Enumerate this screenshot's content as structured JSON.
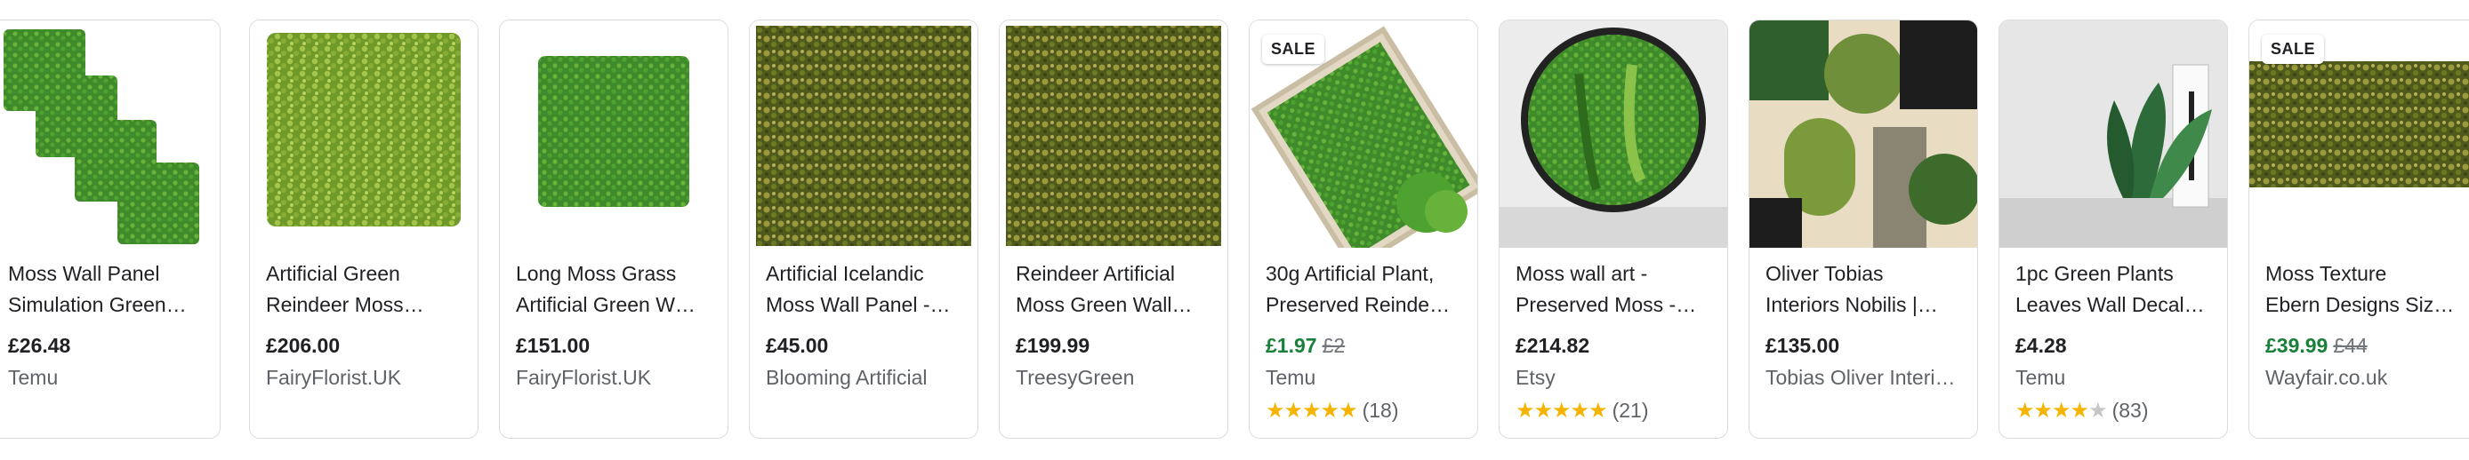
{
  "products": [
    {
      "title1": "Moss Wall Panel",
      "title2": "Simulation Green…",
      "price": "£26.48",
      "old_price": null,
      "sale": false,
      "seller": "Temu",
      "rating": null,
      "reviews": null,
      "badge": null
    },
    {
      "title1": "Artificial Green",
      "title2": "Reindeer Moss…",
      "price": "£206.00",
      "old_price": null,
      "sale": false,
      "seller": "FairyFlorist.UK",
      "rating": null,
      "reviews": null,
      "badge": null
    },
    {
      "title1": "Long Moss Grass",
      "title2": "Artificial Green W…",
      "price": "£151.00",
      "old_price": null,
      "sale": false,
      "seller": "FairyFlorist.UK",
      "rating": null,
      "reviews": null,
      "badge": null
    },
    {
      "title1": "Artificial Icelandic",
      "title2": "Moss Wall Panel -…",
      "price": "£45.00",
      "old_price": null,
      "sale": false,
      "seller": "Blooming Artificial",
      "rating": null,
      "reviews": null,
      "badge": null
    },
    {
      "title1": "Reindeer Artificial",
      "title2": "Moss Green Wall…",
      "price": "£199.99",
      "old_price": null,
      "sale": false,
      "seller": "TreesyGreen",
      "rating": null,
      "reviews": null,
      "badge": null
    },
    {
      "title1": "30g Artificial Plant,",
      "title2": "Preserved Reinde…",
      "price": "£1.97",
      "old_price": "£2",
      "sale": true,
      "seller": "Temu",
      "rating": 4.5,
      "reviews": "(18)",
      "badge": "SALE"
    },
    {
      "title1": "Moss wall art -",
      "title2": "Preserved Moss -…",
      "price": "£214.82",
      "old_price": null,
      "sale": false,
      "seller": "Etsy",
      "rating": 5,
      "reviews": "(21)",
      "badge": null
    },
    {
      "title1": "Oliver Tobias",
      "title2": "Interiors Nobilis |…",
      "price": "£135.00",
      "old_price": null,
      "sale": false,
      "seller": "Tobias Oliver Interi…",
      "rating": null,
      "reviews": null,
      "badge": null
    },
    {
      "title1": "1pc Green Plants",
      "title2": "Leaves Wall Decal…",
      "price": "£4.28",
      "old_price": null,
      "sale": false,
      "seller": "Temu",
      "rating": 4,
      "reviews": "(83)",
      "badge": null
    },
    {
      "title1": "Moss Texture",
      "title2": "Ebern Designs Siz…",
      "price": "£39.99",
      "old_price": "£44",
      "sale": true,
      "seller": "Wayfair.co.uk",
      "rating": null,
      "reviews": null,
      "badge": "SALE"
    }
  ],
  "images": [
    {
      "icon": "moss-tiles-image"
    },
    {
      "icon": "moss-square-image"
    },
    {
      "icon": "moss-square-small-image"
    },
    {
      "icon": "moss-panel-image"
    },
    {
      "icon": "moss-panel-image"
    },
    {
      "icon": "moss-box-image"
    },
    {
      "icon": "round-moss-art-image"
    },
    {
      "icon": "geometric-wallpaper-image"
    },
    {
      "icon": "plant-decal-room-image"
    },
    {
      "icon": "moss-texture-image"
    }
  ]
}
